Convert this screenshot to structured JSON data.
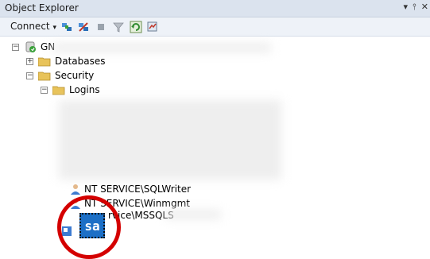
{
  "panel": {
    "title": "Object Explorer",
    "pin_glyph": "▾",
    "pin2_glyph": "⫯",
    "close_glyph": "✕"
  },
  "toolbar": {
    "connect_label": "Connect",
    "connect_caret": "▾",
    "icons": [
      "connect-icon",
      "disconnect-icon",
      "stop-icon",
      "filter-icon",
      "refresh-icon",
      "activity-monitor-icon"
    ]
  },
  "tree": {
    "server_label": "GN",
    "expander_minus": "−",
    "expander_plus": "+",
    "items": {
      "databases": "Databases",
      "security": "Security",
      "logins": "Logins",
      "login_sqlwriter": "NT SERVICE\\SQLWriter",
      "login_winmgmt": "NT SERVICE\\Winmgmt",
      "login_mssql": "rvice\\MSSQLS"
    },
    "sa_label": "sa"
  },
  "colors": {
    "accent": "#1c6fc6",
    "highlight": "#d40000",
    "folder": "#e8c35a"
  }
}
